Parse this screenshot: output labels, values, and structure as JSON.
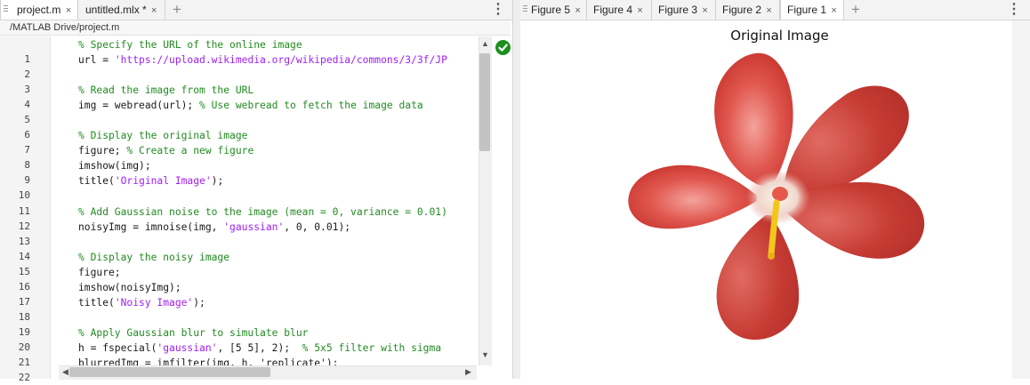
{
  "editor": {
    "tabs": [
      {
        "label": "project.m",
        "close": "×"
      },
      {
        "label": "untitled.mlx *",
        "close": "×"
      }
    ],
    "add_tab": "+",
    "menu": "⋮",
    "file_path": "/MATLAB Drive/project.m",
    "line_numbers": [
      "1",
      "2",
      "3",
      "4",
      "5",
      "6",
      "7",
      "8",
      "9",
      "10",
      "11",
      "12",
      "13",
      "14",
      "15",
      "16",
      "17",
      "18",
      "19",
      "20",
      "21",
      "22"
    ],
    "code_lines": [
      [
        {
          "t": "% Specify the URL of the online image",
          "c": "com"
        }
      ],
      [
        {
          "t": "url = ",
          "c": ""
        },
        {
          "t": "'https://upload.wikimedia.org/wikipedia/commons/3/3f/JP",
          "c": "str"
        }
      ],
      [],
      [
        {
          "t": "% Read the image from the URL",
          "c": "com"
        }
      ],
      [
        {
          "t": "img = webread(url); ",
          "c": ""
        },
        {
          "t": "% Use webread to fetch the image data",
          "c": "com"
        }
      ],
      [],
      [
        {
          "t": "% Display the original image",
          "c": "com"
        }
      ],
      [
        {
          "t": "figure; ",
          "c": ""
        },
        {
          "t": "% Create a new figure",
          "c": "com"
        }
      ],
      [
        {
          "t": "imshow(img);",
          "c": ""
        }
      ],
      [
        {
          "t": "title(",
          "c": ""
        },
        {
          "t": "'Original Image'",
          "c": "str"
        },
        {
          "t": ");",
          "c": ""
        }
      ],
      [],
      [
        {
          "t": "% Add Gaussian noise to the image (mean = 0, variance = 0.01)",
          "c": "com"
        }
      ],
      [
        {
          "t": "noisyImg = imnoise(img, ",
          "c": ""
        },
        {
          "t": "'gaussian'",
          "c": "str"
        },
        {
          "t": ", 0, 0.01);",
          "c": ""
        }
      ],
      [],
      [
        {
          "t": "% Display the noisy image",
          "c": "com"
        }
      ],
      [
        {
          "t": "figure;",
          "c": ""
        }
      ],
      [
        {
          "t": "imshow(noisyImg);",
          "c": ""
        }
      ],
      [
        {
          "t": "title(",
          "c": ""
        },
        {
          "t": "'Noisy Image'",
          "c": "str"
        },
        {
          "t": ");",
          "c": ""
        }
      ],
      [],
      [
        {
          "t": "% Apply Gaussian blur to simulate blur",
          "c": "com"
        }
      ],
      [
        {
          "t": "h = fspecial(",
          "c": ""
        },
        {
          "t": "'gaussian'",
          "c": "str"
        },
        {
          "t": ", [5 5], 2);  ",
          "c": ""
        },
        {
          "t": "% 5x5 filter with sigma",
          "c": "com"
        }
      ],
      [
        {
          "t": "blurredImg = imfilter(img, h, 'replicate');",
          "c": ""
        }
      ]
    ],
    "status": "ok"
  },
  "figures": {
    "tabs": [
      {
        "label": "Figure 5",
        "close": "×"
      },
      {
        "label": "Figure 4",
        "close": "×"
      },
      {
        "label": "Figure 3",
        "close": "×"
      },
      {
        "label": "Figure 2",
        "close": "×"
      },
      {
        "label": "Figure 1",
        "close": "×"
      }
    ],
    "add_tab": "+",
    "menu": "⋮",
    "title": "Original Image"
  },
  "colors": {
    "comment": "#228b22",
    "string": "#a020f0",
    "petal": "#d0413a",
    "petal_light": "#ec8d86",
    "stamen": "#f2c71b",
    "status_ok": "#1d8f1d"
  },
  "icons": [
    "grip-icon",
    "close-icon",
    "plus-icon",
    "more-icon",
    "check-icon",
    "arrow-up-icon",
    "arrow-down-icon",
    "arrow-left-icon",
    "arrow-right-icon"
  ]
}
